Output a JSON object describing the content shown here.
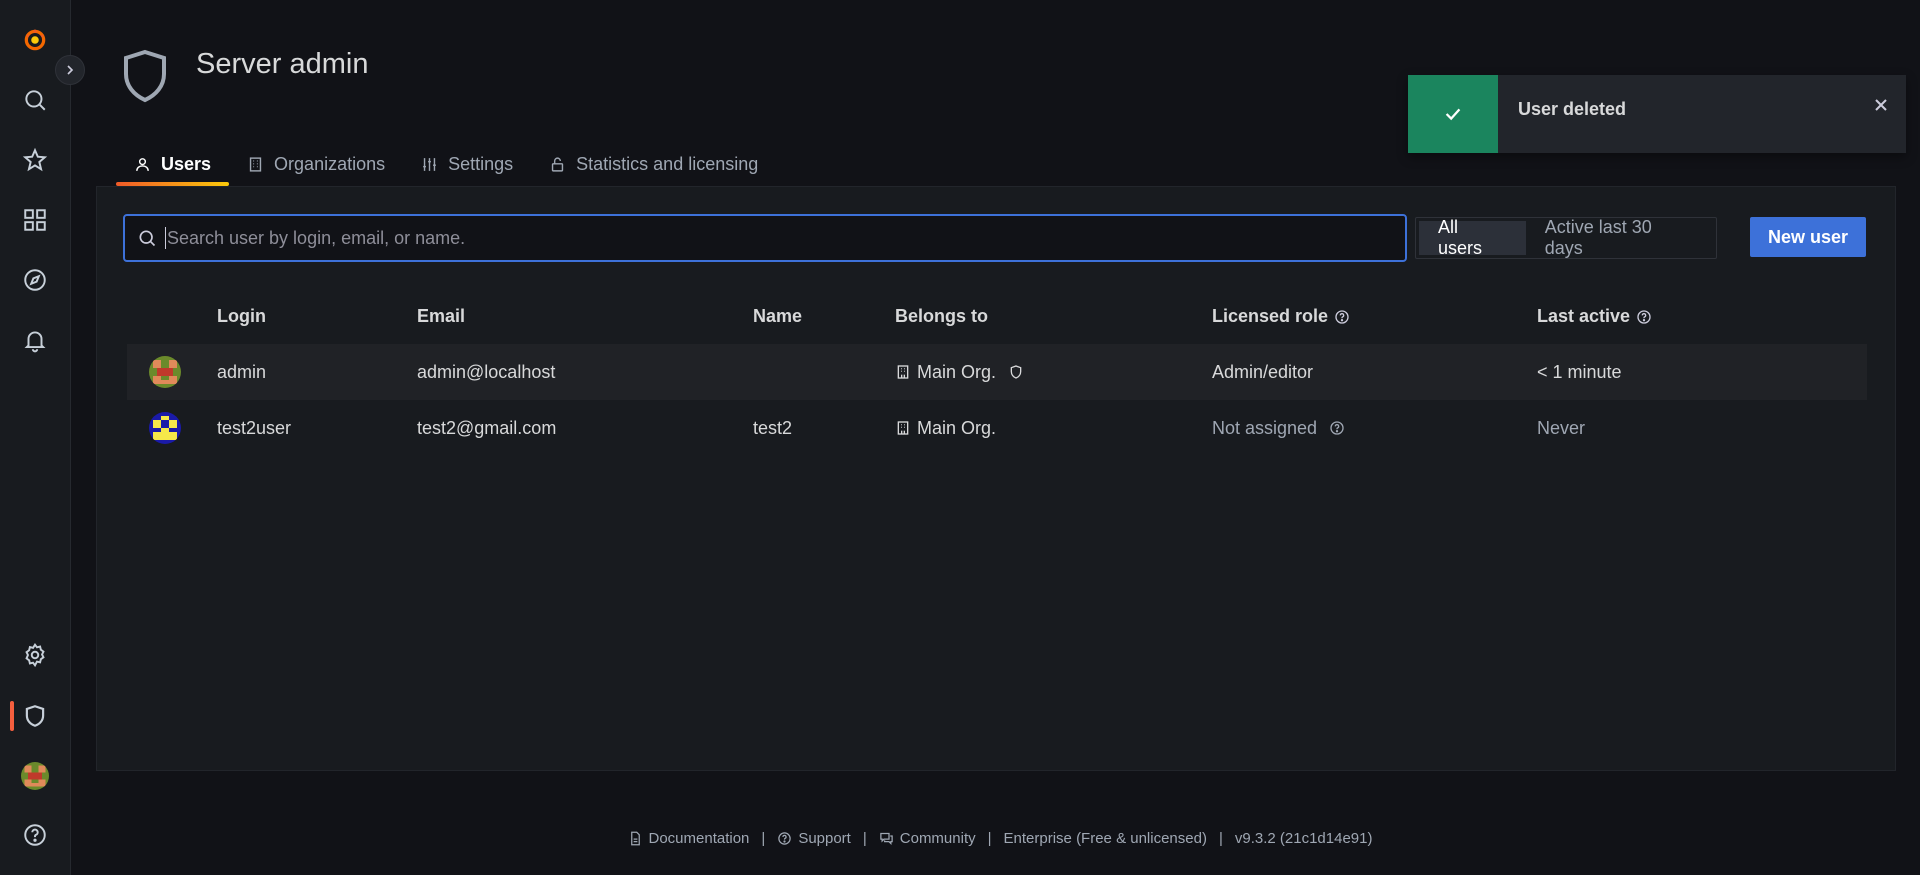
{
  "page": {
    "title": "Server admin"
  },
  "tabs": [
    {
      "label": "Users",
      "icon": "user-icon",
      "active": true
    },
    {
      "label": "Organizations",
      "icon": "building-icon"
    },
    {
      "label": "Settings",
      "icon": "sliders-icon"
    },
    {
      "label": "Statistics and licensing",
      "icon": "lock-icon"
    }
  ],
  "search": {
    "placeholder": "Search user by login, email, or name."
  },
  "filter": {
    "options": [
      "All users",
      "Active last 30 days"
    ],
    "selected": "All users"
  },
  "new_user_label": "New user",
  "table": {
    "headers": [
      "Login",
      "Email",
      "Name",
      "Belongs to",
      "Licensed role",
      "Last active"
    ],
    "rows": [
      {
        "login": "admin",
        "email": "admin@localhost",
        "name": "",
        "org": "Main Org.",
        "role": "Admin/editor",
        "last_active": "< 1 minute"
      },
      {
        "login": "test2user",
        "email": "test2@gmail.com",
        "name": "test2",
        "org": "Main Org.",
        "role": "Not assigned",
        "last_active": "Never"
      }
    ]
  },
  "toast": {
    "message": "User deleted",
    "status_color": "#1b855e"
  },
  "footer": {
    "documentation": "Documentation",
    "support": "Support",
    "community": "Community",
    "edition": "Enterprise (Free & unlicensed)",
    "version": "v9.3.2 (21c1d14e91)"
  },
  "colors": {
    "accent": "#3d71d9",
    "active_tab": "#f05a28",
    "sidebar_active": "#f55f3e"
  }
}
